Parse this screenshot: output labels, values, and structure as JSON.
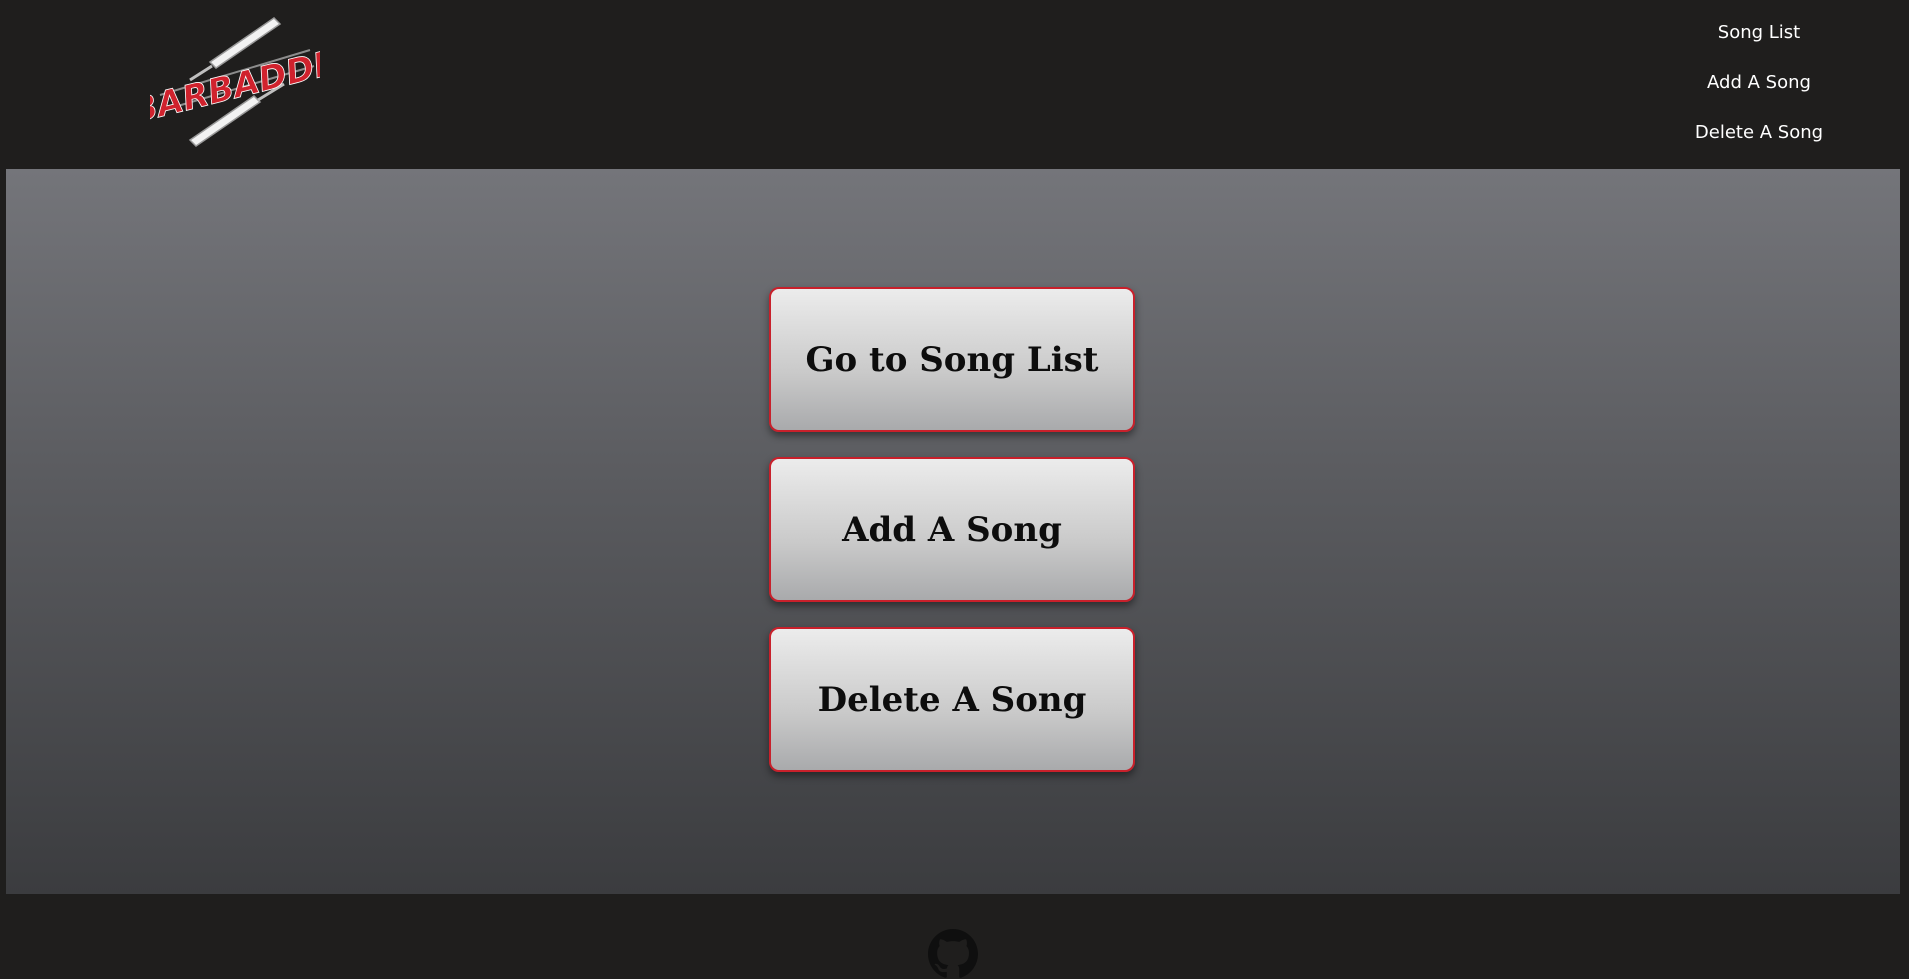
{
  "header": {
    "logo_text": "BARBADDE",
    "logo_icon": "crossed-razors-logo"
  },
  "nav": {
    "items": [
      {
        "label": "Song List"
      },
      {
        "label": "Add A Song"
      },
      {
        "label": "Delete A Song"
      }
    ]
  },
  "main": {
    "buttons": [
      {
        "label": "Go to Song List"
      },
      {
        "label": "Add A Song"
      },
      {
        "label": "Delete A Song"
      }
    ]
  },
  "footer": {
    "icon": "github-icon"
  },
  "colors": {
    "accent": "#c8202b",
    "background": "#1f1e1d",
    "nav_text": "#ffffff"
  }
}
